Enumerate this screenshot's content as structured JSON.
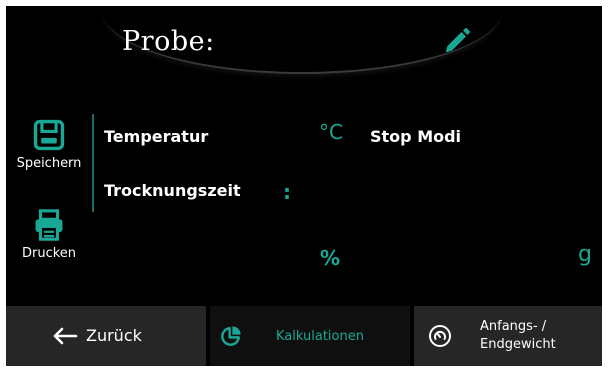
{
  "header": {
    "title": "Probe:",
    "edit_icon": "pencil-icon"
  },
  "sidebar": {
    "save_label": "Speichern",
    "save_icon": "floppy-disk-icon",
    "print_label": "Drucken",
    "print_icon": "printer-icon"
  },
  "main": {
    "temperature_label": "Temperatur",
    "temperature_unit": "°C",
    "stop_mode_label": "Stop Modi",
    "drying_time_label": "Trocknungszeit",
    "drying_time_separator": ":",
    "percent_unit": "%",
    "gram_unit": "g"
  },
  "bottom_bar": {
    "back_label": "Zurück",
    "back_icon": "arrow-left-icon",
    "calc_label": "Kalkulationen",
    "calc_icon": "pie-chart-icon",
    "weight_label_line1": "Anfangs- /",
    "weight_label_line2": "Endgewicht",
    "weight_icon": "gauge-icon"
  },
  "colors": {
    "accent": "#1aa896",
    "background": "#000000",
    "tab_bar": "#262626"
  }
}
